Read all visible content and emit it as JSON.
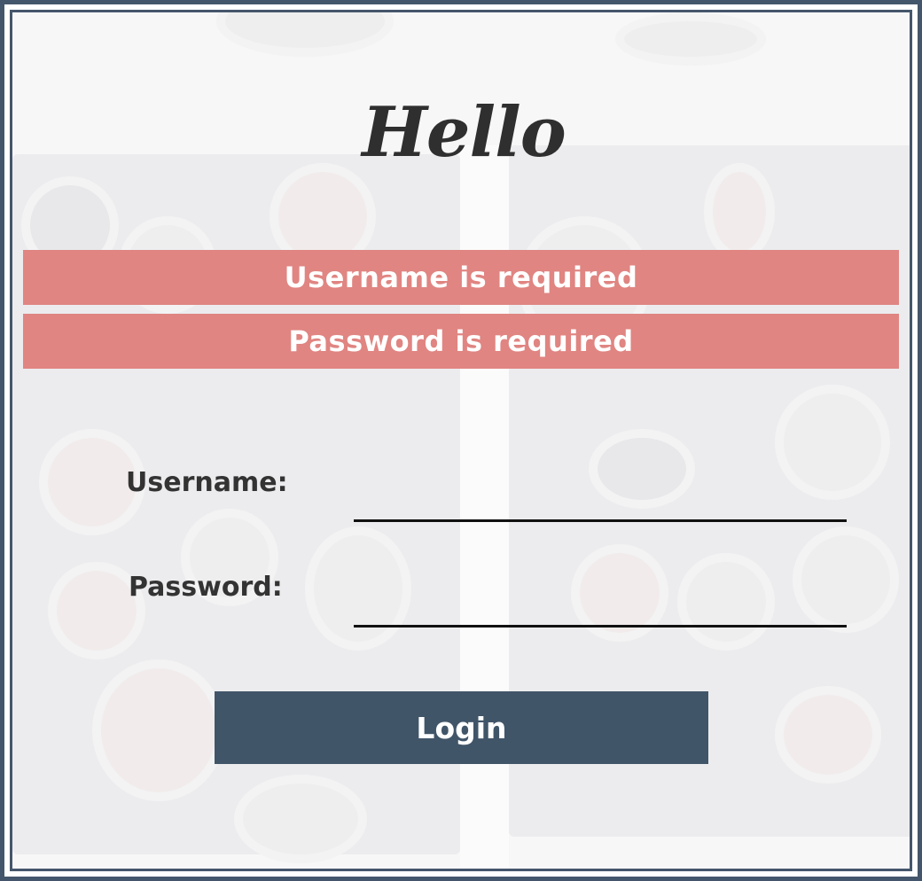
{
  "form": {
    "title": "Hello",
    "errors": [
      "Username is required",
      "Password is required"
    ],
    "username_label": "Username:",
    "username_value": "",
    "password_label": "Password:",
    "password_value": "",
    "login_label": "Login"
  },
  "colors": {
    "frame": "#44566b",
    "error_background": "#e08582",
    "button_background": "#415569",
    "title_text": "#2f2f2f"
  }
}
